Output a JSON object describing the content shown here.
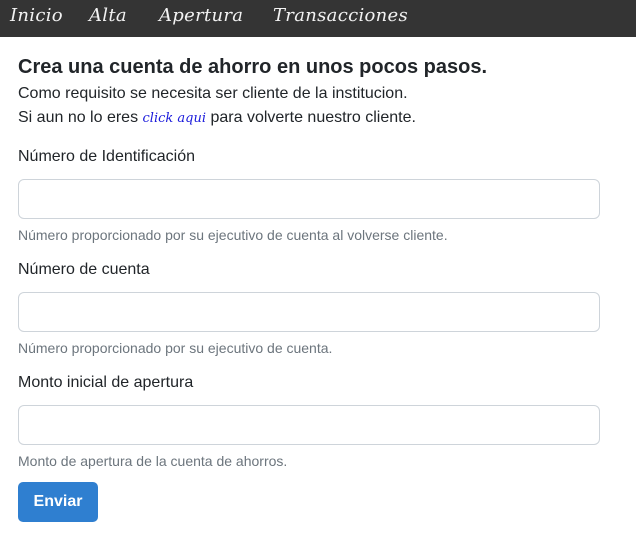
{
  "nav": {
    "items": [
      "Inicio",
      "Alta",
      "Apertura",
      "Transacciones"
    ]
  },
  "header": {
    "title": "Crea una cuenta de ahorro en unos pocos pasos.",
    "line1": "Como requisito se necesita ser cliente de la institucion.",
    "line2_prefix": "Si aun no lo eres ",
    "link_text": "click aqui",
    "line2_suffix": " para volverte nuestro cliente."
  },
  "form": {
    "fields": [
      {
        "label": "Número de Identificación",
        "value": "",
        "help": "Número proporcionado por su ejecutivo de cuenta al volverse cliente."
      },
      {
        "label": "Número de cuenta",
        "value": "",
        "help": "Número proporcionado por su ejecutivo de cuenta."
      },
      {
        "label": "Monto inicial de apertura",
        "value": "",
        "help": "Monto de apertura de la cuenta de ahorros."
      }
    ],
    "submit_label": "Enviar"
  },
  "colors": {
    "navbar_bg": "#343434",
    "primary_button": "#2f7fd0",
    "link": "#1a1adb",
    "help_text": "#6c757d"
  }
}
